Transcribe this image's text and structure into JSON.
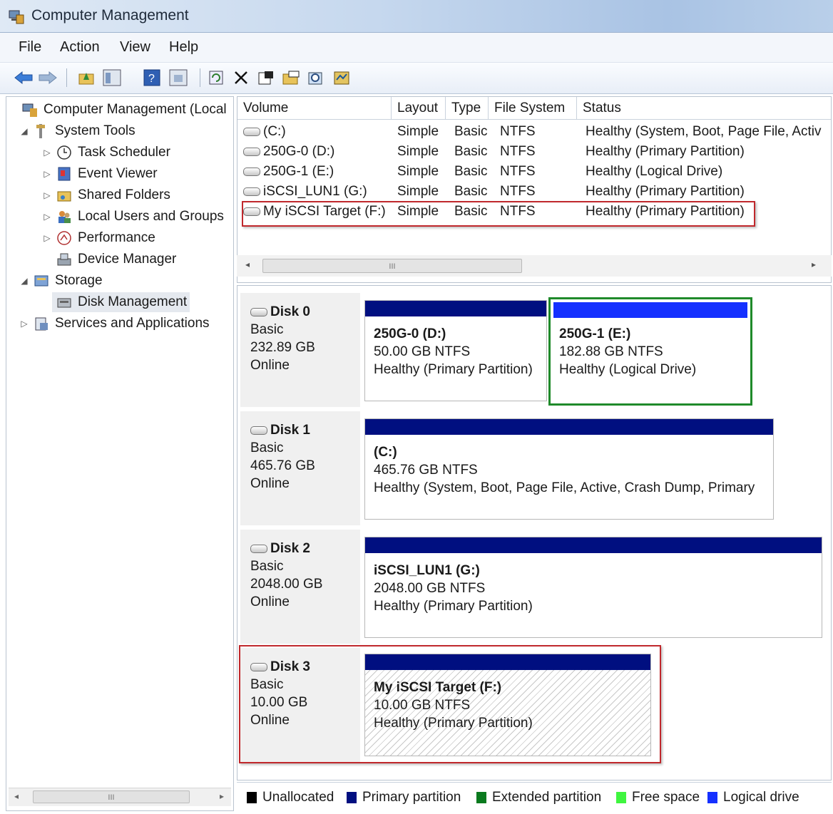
{
  "window": {
    "title": "Computer Management"
  },
  "menu": [
    "File",
    "Action",
    "View",
    "Help"
  ],
  "toolbar_icons": [
    "back-arrow-icon",
    "forward-arrow-icon",
    "up-folder-icon",
    "show-hide-tree-icon",
    "help-icon",
    "console-icon",
    "refresh-icon",
    "delete-icon",
    "properties-icon",
    "open-icon",
    "search-icon",
    "disk-properties-icon"
  ],
  "tree": {
    "root": "Computer Management (Local",
    "system_tools": "System Tools",
    "task_scheduler": "Task Scheduler",
    "event_viewer": "Event Viewer",
    "shared_folders": "Shared Folders",
    "local_users": "Local Users and Groups",
    "performance": "Performance",
    "device_manager": "Device Manager",
    "storage": "Storage",
    "disk_management": "Disk Management",
    "services": "Services and Applications",
    "scroll_mark": "III"
  },
  "volume_list": {
    "columns": [
      "Volume",
      "Layout",
      "Type",
      "File System",
      "Status"
    ],
    "rows": [
      {
        "volume": "(C:)",
        "layout": "Simple",
        "type": "Basic",
        "fs": "NTFS",
        "status": "Healthy (System, Boot, Page File, Activ"
      },
      {
        "volume": "250G-0 (D:)",
        "layout": "Simple",
        "type": "Basic",
        "fs": "NTFS",
        "status": "Healthy (Primary Partition)"
      },
      {
        "volume": "250G-1 (E:)",
        "layout": "Simple",
        "type": "Basic",
        "fs": "NTFS",
        "status": "Healthy (Logical Drive)"
      },
      {
        "volume": "iSCSI_LUN1 (G:)",
        "layout": "Simple",
        "type": "Basic",
        "fs": "NTFS",
        "status": "Healthy (Primary Partition)"
      },
      {
        "volume": "My iSCSI Target (F:)",
        "layout": "Simple",
        "type": "Basic",
        "fs": "NTFS",
        "status": "Healthy (Primary Partition)"
      }
    ],
    "scroll_mark": "III"
  },
  "disks": [
    {
      "name": "Disk 0",
      "type": "Basic",
      "size": "232.89 GB",
      "status": "Online",
      "partitions": [
        {
          "name": "250G-0  (D:)",
          "size": "50.00 GB NTFS",
          "status": "Healthy (Primary Partition)"
        },
        {
          "name": "250G-1  (E:)",
          "size": "182.88 GB NTFS",
          "status": "Healthy (Logical Drive)"
        }
      ]
    },
    {
      "name": "Disk 1",
      "type": "Basic",
      "size": "465.76 GB",
      "status": "Online",
      "partitions": [
        {
          "name": "(C:)",
          "size": "465.76 GB NTFS",
          "status": "Healthy (System, Boot, Page File, Active, Crash Dump, Primary"
        }
      ]
    },
    {
      "name": "Disk 2",
      "type": "Basic",
      "size": "2048.00 GB",
      "status": "Online",
      "partitions": [
        {
          "name": "iSCSI_LUN1  (G:)",
          "size": "2048.00 GB NTFS",
          "status": "Healthy (Primary Partition)"
        }
      ]
    },
    {
      "name": "Disk 3",
      "type": "Basic",
      "size": "10.00 GB",
      "status": "Online",
      "partitions": [
        {
          "name": "My iSCSI Target  (F:)",
          "size": "10.00 GB NTFS",
          "status": "Healthy (Primary Partition)"
        }
      ]
    }
  ],
  "legend": [
    {
      "label": "Unallocated",
      "color": "#000000"
    },
    {
      "label": "Primary partition",
      "color": "#000f80"
    },
    {
      "label": "Extended partition",
      "color": "#0a7a1e"
    },
    {
      "label": "Free space",
      "color": "#3ff53f"
    },
    {
      "label": "Logical drive",
      "color": "#1530ff"
    }
  ],
  "colors": {
    "primary_bar": "#000f80",
    "logical_bar": "#1530ff",
    "highlight_red": "#c0282c",
    "highlight_green": "#1f8a2a"
  }
}
